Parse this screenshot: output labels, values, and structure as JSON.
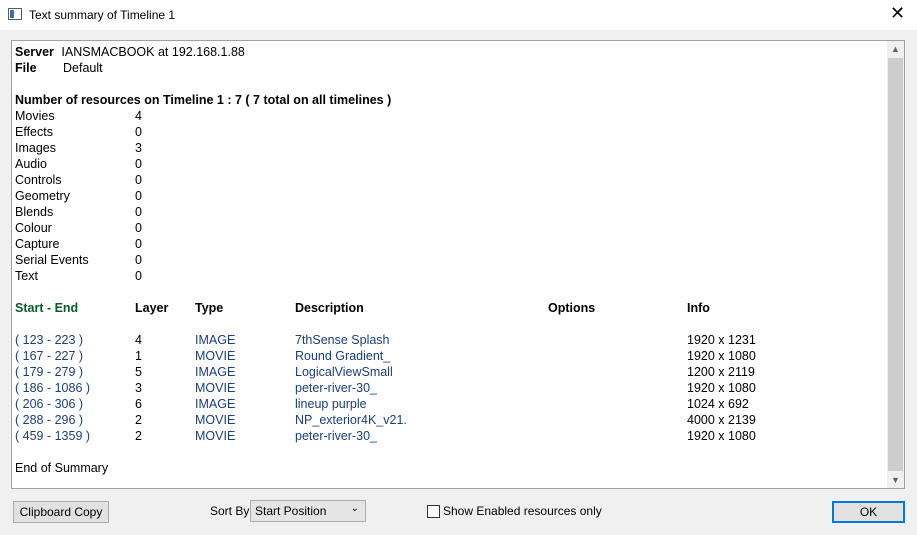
{
  "window": {
    "title": "Text summary of Timeline 1"
  },
  "summary": {
    "server_label": "Server",
    "server_value": "IANSMACBOOK  at 192.168.1.88",
    "file_label": "File",
    "file_value": "Default",
    "resources_heading": "Number of resources on Timeline 1 : 7  ( 7 total on all timelines )",
    "resources": [
      {
        "name": "Movies",
        "count": "4"
      },
      {
        "name": "Effects",
        "count": "0"
      },
      {
        "name": "Images",
        "count": "3"
      },
      {
        "name": "Audio",
        "count": "0"
      },
      {
        "name": "Controls",
        "count": "0"
      },
      {
        "name": "Geometry",
        "count": "0"
      },
      {
        "name": "Blends",
        "count": "0"
      },
      {
        "name": "Colour",
        "count": "0"
      },
      {
        "name": "Capture",
        "count": "0"
      },
      {
        "name": "Serial Events",
        "count": "0"
      },
      {
        "name": "Text",
        "count": "0"
      }
    ],
    "columns": [
      "Start - End",
      "Layer",
      "Type",
      "Description",
      "Options",
      "Info"
    ],
    "rows": [
      {
        "range": "( 123 - 223 )",
        "layer": "4",
        "type": "IMAGE",
        "description": "7thSense Splash",
        "options": "",
        "info": "1920 x 1231"
      },
      {
        "range": "( 167 - 227 )",
        "layer": "1",
        "type": "MOVIE",
        "description": "Round Gradient_",
        "options": "",
        "info": "1920 x 1080"
      },
      {
        "range": "( 179 - 279 )",
        "layer": "5",
        "type": "IMAGE",
        "description": "LogicalViewSmall",
        "options": "",
        "info": "1200 x 2119"
      },
      {
        "range": "( 186 - 1086 )",
        "layer": "3",
        "type": "MOVIE",
        "description": "peter-river-30_",
        "options": "",
        "info": "1920 x 1080"
      },
      {
        "range": "( 206 - 306 )",
        "layer": "6",
        "type": "IMAGE",
        "description": "lineup purple",
        "options": "",
        "info": "1024 x 692"
      },
      {
        "range": "( 288 - 296 )",
        "layer": "2",
        "type": "MOVIE",
        "description": "NP_exterior4K_v21.",
        "options": "",
        "info": "4000 x 2139"
      },
      {
        "range": "( 459 - 1359 )",
        "layer": "2",
        "type": "MOVIE",
        "description": "peter-river-30_",
        "options": "",
        "info": "1920 x 1080"
      }
    ],
    "end_text": "End of Summary"
  },
  "footer": {
    "clipboard_label": "Clipboard Copy",
    "sortby_label": "Sort By",
    "sortby_value": "Start Position",
    "checkbox_label": "Show Enabled resources only",
    "checkbox_checked": false,
    "ok_label": "OK"
  },
  "icons": {
    "close": "close-icon",
    "app": "window-icon",
    "scroll_up": "chevron-up-icon",
    "scroll_down": "chevron-down-icon",
    "dropdown": "chevron-down-icon"
  }
}
